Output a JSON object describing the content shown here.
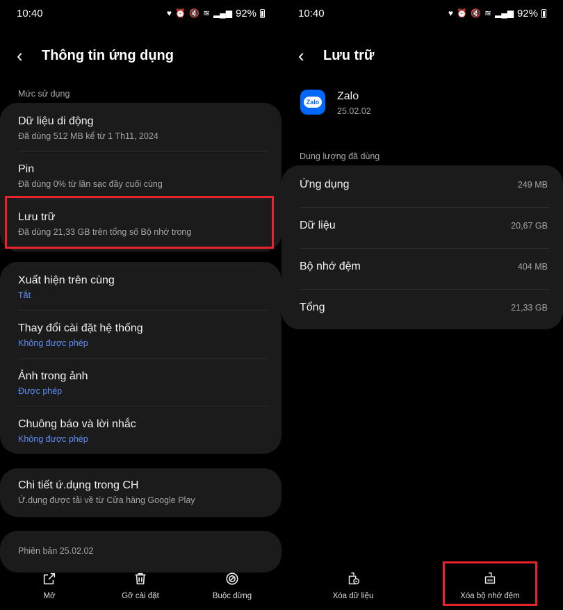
{
  "left": {
    "status": {
      "time": "10:40",
      "battery": "92%"
    },
    "header": {
      "title": "Thông tin ứng dụng"
    },
    "usage_label": "Mức sử dụng",
    "usage_items": [
      {
        "title": "Dữ liệu di động",
        "subtitle": "Đã dùng 512 MB kể từ 1 Th11, 2024"
      },
      {
        "title": "Pin",
        "subtitle": "Đã dùng 0% từ lần sạc đầy cuối cùng"
      },
      {
        "title": "Lưu trữ",
        "subtitle": "Đã dùng 21,33 GB trên tổng số Bộ nhớ trong"
      }
    ],
    "permission_items": [
      {
        "title": "Xuất hiện trên cùng",
        "subtitle": "Tắt"
      },
      {
        "title": "Thay đổi cài đặt hệ thống",
        "subtitle": "Không được phép"
      },
      {
        "title": "Ảnh trong ảnh",
        "subtitle": "Được phép"
      },
      {
        "title": "Chuông báo và lời nhắc",
        "subtitle": "Không được phép"
      }
    ],
    "store": {
      "title": "Chi tiết ứ.dụng trong CH",
      "subtitle": "Ứ.dụng được tải về từ Cửa hàng Google Play"
    },
    "version": "Phiên bản 25.02.02",
    "actions": {
      "open": "Mở",
      "uninstall": "Gỡ cài đặt",
      "force_stop": "Buộc dừng"
    }
  },
  "right": {
    "status": {
      "time": "10:40",
      "battery": "92%"
    },
    "header": {
      "title": "Lưu trữ"
    },
    "app": {
      "name": "Zalo",
      "version": "25.02.02",
      "logo_text": "Zalo"
    },
    "used_label": "Dung lượng đã dùng",
    "storage": [
      {
        "label": "Ứng dụng",
        "value": "249 MB"
      },
      {
        "label": "Dữ liệu",
        "value": "20,67 GB"
      },
      {
        "label": "Bộ nhớ đệm",
        "value": "404 MB"
      },
      {
        "label": "Tổng",
        "value": "21,33 GB"
      }
    ],
    "actions": {
      "clear_data": "Xóa dữ liệu",
      "clear_cache": "Xóa bộ nhớ đệm"
    }
  },
  "colors": {
    "highlight": "#e8232d",
    "link_blue": "#5f8df5",
    "card": "#1b1b1b"
  }
}
